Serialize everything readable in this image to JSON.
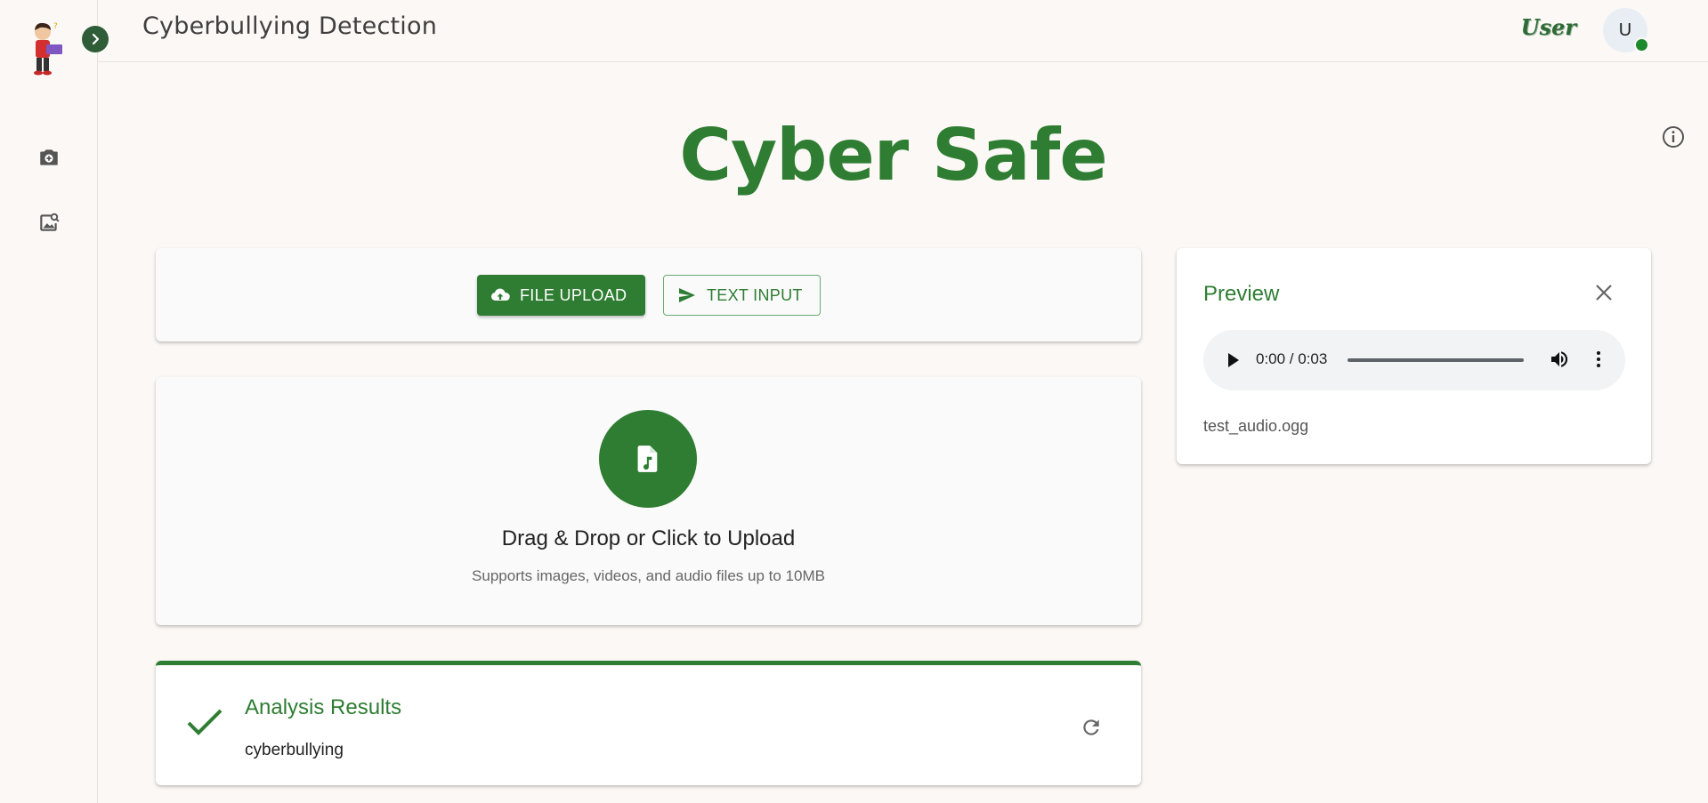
{
  "app": {
    "title": "Cyberbullying Detection"
  },
  "header": {
    "user_label": "User",
    "avatar_initial": "U"
  },
  "hero": {
    "title": "Cyber Safe"
  },
  "sidebar": {
    "items": [
      {
        "name": "capture",
        "icon": "add-photo-camera-icon"
      },
      {
        "name": "image-search",
        "icon": "image-search-icon"
      }
    ]
  },
  "mode_tabs": {
    "file_upload_label": "FILE UPLOAD",
    "text_input_label": "TEXT INPUT",
    "active": "file_upload"
  },
  "upload": {
    "heading": "Drag & Drop or Click to Upload",
    "subtext": "Supports images, videos, and audio files up to 10MB",
    "icon": "audio-file-icon"
  },
  "results": {
    "title": "Analysis Results",
    "value": "cyberbullying",
    "status_icon": "check-icon"
  },
  "preview": {
    "title": "Preview",
    "audio_time": "0:00 / 0:03",
    "progress_fraction": 0,
    "file_name": "test_audio.ogg"
  },
  "colors": {
    "accent": "#2e7d32",
    "background": "#fcf8f5",
    "status_online": "#1b8a2a"
  }
}
